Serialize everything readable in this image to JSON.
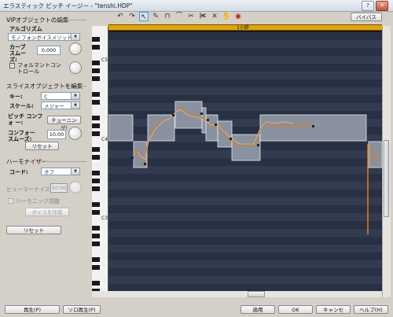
{
  "window": {
    "title": "エラスティック ピッチ イージー - \"tenshi.HDP\"",
    "controls": [
      "?",
      "✕"
    ]
  },
  "toolbar": {
    "icons": [
      "undo-icon",
      "redo-icon",
      "arrow-select-icon",
      "pencil-icon",
      "pulse-icon",
      "curve-icon",
      "split-icon",
      "scissors-icon",
      "x-icon",
      "hand-icon",
      "zoom-icon"
    ],
    "bypass_label": "バイパス"
  },
  "vip": {
    "header": "VIPオブジェクトの編集",
    "algorithm_label": "アルゴリズム",
    "algorithm_value": "モノフォンボイスメソッド",
    "curve_smooth_label": "カーブ スムーズ:",
    "curve_smooth_value": "0.000",
    "formant_checkbox_label": "フォルマントコントロール",
    "formant_checked": true
  },
  "slice": {
    "header": "スライスオブジェクトを編集",
    "key_label": "キー:",
    "key_value": "C",
    "scale_label": "スケール:",
    "scale_value": "メジャー",
    "pitch_conform_label": "ピッチ コンフォ ー:",
    "pitch_conform_button": "チューニング!",
    "conform_smooth_label": "コンフォー スムーズ:",
    "conform_smooth_value": "10.00",
    "reset_label": "リセット"
  },
  "harmonizer": {
    "header": "ハーモナイザー",
    "chord_label": "コード:",
    "chord_value": "オフ",
    "humanize_label": "ヒューマーナイズ:",
    "humanize_value": "10.00",
    "harmonic_adjust_label": "ハーモニック調整",
    "create_voice_label": "ボイスを作成"
  },
  "reset_all_label": "リセット",
  "editor": {
    "bar_label": "1小節",
    "octave_labels": [
      "C5",
      "C4",
      "C3"
    ]
  },
  "footer": {
    "play_label": "再生(P)",
    "solo_play_label": "ソロ再生(P)",
    "apply_label": "適用",
    "ok_label": "OK",
    "cancel_label": "キャンセ",
    "help_label": "ヘルプ(H)"
  },
  "colors": {
    "accent": "#e8a300",
    "editor_bg": "#151a26",
    "note_fill": "#9aa2ae",
    "pitch_curve": "#e07a10"
  }
}
